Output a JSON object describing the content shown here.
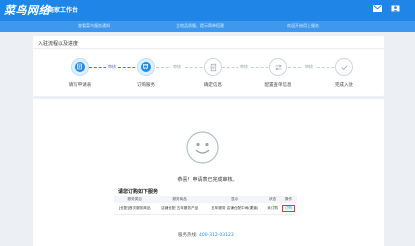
{
  "colors": {
    "brand": "#1f86e8",
    "strip": "#3e99ee",
    "accent": "#1c8ce9",
    "page_bg": "#ecf0f5",
    "highlight_red": "#e23a2e"
  },
  "header": {
    "logo": "菜鸟网络",
    "workbench": "商家工作台",
    "icons": [
      "mail-icon",
      "user-icon"
    ]
  },
  "notice": {
    "items": [
      "查看菜鸟服务通知",
      "立地品质服、提示简单搭建",
      "欢迎开始用上服务"
    ]
  },
  "progress": {
    "title": "入驻流程以及进度",
    "steps": [
      {
        "label": "填写申请表",
        "status": "done",
        "icon": "form-icon"
      },
      {
        "label": "订购服务",
        "status": "done",
        "icon": "cart-icon"
      },
      {
        "label": "确定信息",
        "status": "todo",
        "icon": "document-icon"
      },
      {
        "label": "配置查单信息",
        "status": "todo",
        "icon": "exchange-icon"
      },
      {
        "label": "完成入驻",
        "status": "todo",
        "icon": "check-icon"
      }
    ],
    "connectors": [
      "审核",
      "审核",
      "审核",
      "审核"
    ]
  },
  "result": {
    "icon": "smiley-icon",
    "message": "恭喜！申请表已完成审核。",
    "subscribe_title": "请您订购如下服务",
    "table": {
      "headers": [
        "服务类目",
        "服务商品",
        "显示",
        "状态",
        "操作"
      ],
      "rows": [
        {
          "category": "[仓配]首次服务商品",
          "product": "店铺仓配 五年服务产品",
          "display": "五年服务 店铺仓配中间(渠道)",
          "status": "未订购",
          "action": "订购"
        }
      ]
    },
    "hotline_label": "服务热线:",
    "hotline_number": "400-312-03123"
  }
}
